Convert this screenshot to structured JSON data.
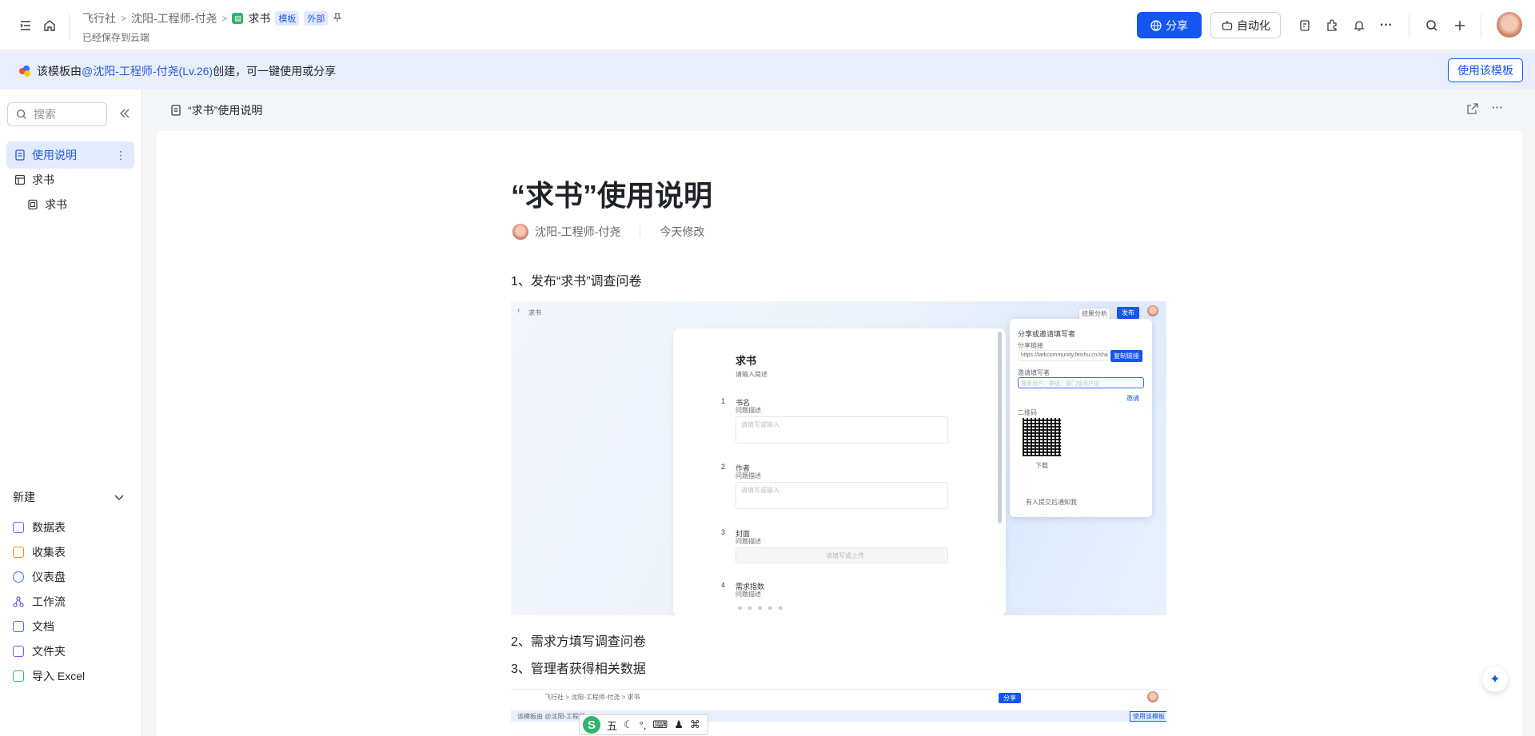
{
  "topbar": {
    "breadcrumb": [
      "飞行社",
      "沈阳-工程师-付尧",
      "求书"
    ],
    "tags": [
      "模板",
      "外部"
    ],
    "saved_status": "已经保存到云端",
    "share_label": "分享",
    "automation_label": "自动化"
  },
  "banner": {
    "prefix": "该模板由 ",
    "author_link": "@沈阳-工程师-付尧(Lv.26)",
    "suffix": " 创建，可一键使用或分享",
    "use_button": "使用该模板"
  },
  "sidebar": {
    "search_placeholder": "搜索",
    "items": [
      {
        "label": "使用说明"
      },
      {
        "label": "求书"
      },
      {
        "label": "求书"
      }
    ],
    "new_label": "新建",
    "new_items": [
      {
        "label": "数据表",
        "color": "#7a5af5"
      },
      {
        "label": "收集表",
        "color": "#f08a24"
      },
      {
        "label": "仪表盘",
        "color": "#3370ff"
      },
      {
        "label": "工作流",
        "color": "#7a5af5"
      },
      {
        "label": "文档",
        "color": "#3370ff"
      },
      {
        "label": "文件夹",
        "color": "#7a5af5"
      },
      {
        "label": "导入 Excel",
        "color": "#2fb46d"
      }
    ]
  },
  "main": {
    "header_title": "“求书”使用说明",
    "title": "“求书”使用说明",
    "author": "沈阳-工程师-付尧",
    "modified": "今天修改",
    "steps": [
      "1、发布“求书”调查问卷",
      "2、需求方填写调查问卷",
      "3、管理者获得相关数据"
    ]
  },
  "screenshot1": {
    "back_title": "求书",
    "form_title": "求书",
    "form_desc": "请输入简述",
    "q1_num": "1",
    "q1": "书名",
    "q2_num": "2",
    "q2": "作者",
    "q3_num": "3",
    "q3": "封面",
    "q4_num": "4",
    "q4": "需求指数",
    "q_hint": "问题描述",
    "input_ph": "请填写或输入",
    "upload_ph": "请填写或上传",
    "stats_label": "结果分析",
    "publish_label": "发布",
    "panel_title": "分享或邀请填写者",
    "share_link_label": "分享链接",
    "share_url": "https://larkcommunity.feishu.cn/sha",
    "copy_label": "复制链接",
    "invite_label": "邀请填写者",
    "invite_ph": "搜索用户、群组、部门或用户组",
    "invite_btn": "邀请",
    "qr_label": "二维码",
    "download_label": "下载",
    "checkbox_label": "有人提交后通知我"
  },
  "screenshot2": {
    "crumbs": "飞行社 > 沈阳-工程师-付尧 > 求书",
    "banner": "该模板由 @沈阳-工程师",
    "use": "使用该模板"
  },
  "ime": {
    "mode": "五"
  }
}
